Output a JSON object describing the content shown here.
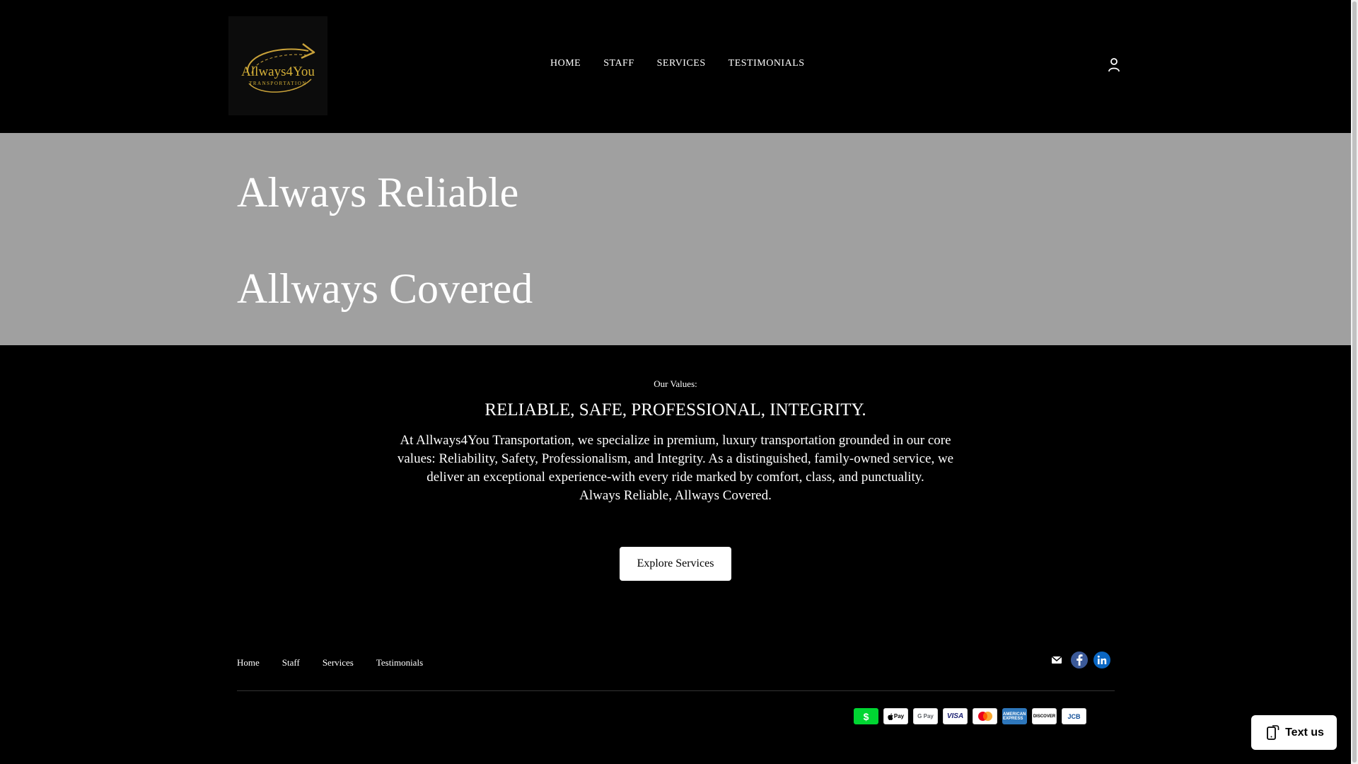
{
  "header": {
    "logo": {
      "text": "Allways4You",
      "subtext": "TRANSPORTATION",
      "icon": "arrow-road-logo-icon"
    },
    "nav": [
      {
        "label": "HOME"
      },
      {
        "label": "STAFF"
      },
      {
        "label": "SERVICES"
      },
      {
        "label": "TESTIMONIALS"
      }
    ],
    "account_icon": "person-icon"
  },
  "hero": {
    "line1": "Always Reliable",
    "line2": "Allways Covered",
    "background": "#a0a0a0"
  },
  "values": {
    "label": "Our Values:",
    "heading": "RELIABLE, SAFE, PROFESSIONAL, INTEGRITY.",
    "body": "At Allways4You Transportation, we specialize in premium, luxury transportation grounded in our core values: Reliability, Safety, Professionalism, and Integrity. As a distinguished, family-owned service, we deliver an exceptional experience-with every ride marked by comfort, class, and punctuality.",
    "tagline": "Always Reliable, Allways Covered.",
    "button_label": "Explore Services"
  },
  "footer": {
    "links": [
      {
        "label": "Home"
      },
      {
        "label": "Staff"
      },
      {
        "label": "Services"
      },
      {
        "label": "Testimonials"
      }
    ],
    "social": [
      "mail-icon",
      "facebook-icon",
      "linkedin-icon"
    ],
    "payments": [
      {
        "name": "cash-app",
        "label": "$"
      },
      {
        "name": "apple-pay",
        "label": "Pay"
      },
      {
        "name": "google-pay",
        "label": "G Pay"
      },
      {
        "name": "visa",
        "label": "VISA"
      },
      {
        "name": "mastercard",
        "label": ""
      },
      {
        "name": "amex",
        "label": "AMERICAN EXPRESS"
      },
      {
        "name": "discover",
        "label": "DISCOVER"
      },
      {
        "name": "jcb",
        "label": "JCB"
      }
    ]
  },
  "chat": {
    "label": "Text us"
  },
  "colors": {
    "background": "#000000",
    "hero": "#a0a0a0",
    "gold": "#c9a23a",
    "cashapp": "#00d632",
    "facebook": "#3b5998",
    "linkedin": "#0a66c2"
  }
}
